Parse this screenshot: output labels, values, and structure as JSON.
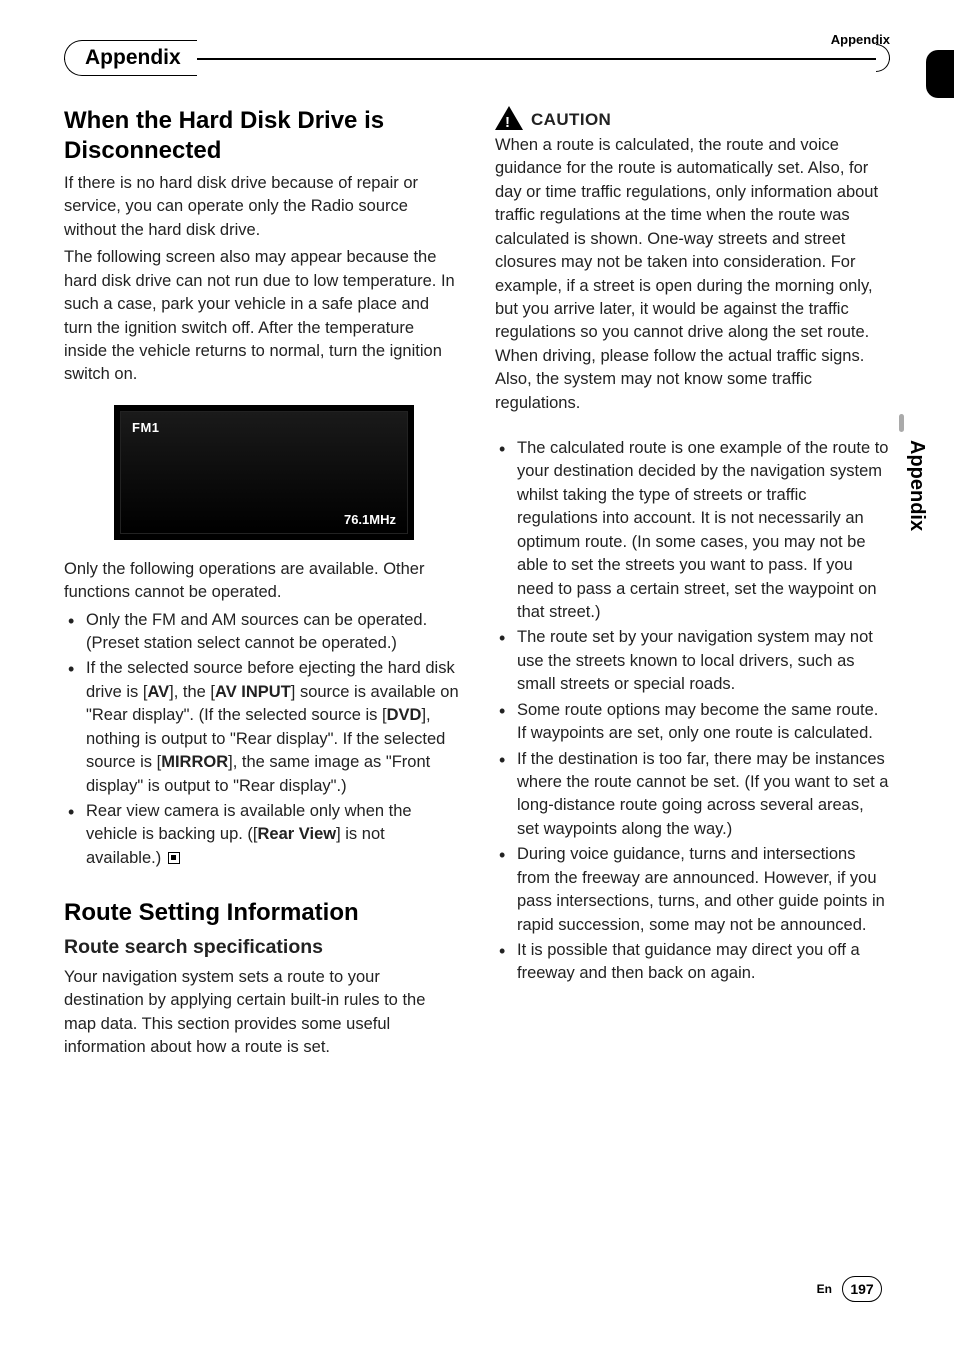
{
  "header": {
    "rightLabel": "Appendix",
    "tabTitle": "Appendix"
  },
  "left": {
    "h1": "When the Hard Disk Drive is Disconnected",
    "p1": "If there is no hard disk drive because of repair or service, you can operate only the Radio source without the hard disk drive.",
    "p2": "The following screen also may appear because the hard disk drive can not run due to low temperature. In such a case, park your vehicle in a safe place and turn the ignition switch off. After the temperature inside the vehicle returns to normal, turn the ignition switch on.",
    "screen": {
      "band": "FM1",
      "freq": "76.1MHz"
    },
    "p3": "Only the following operations are available. Other functions cannot be operated.",
    "bullets": {
      "b1": "Only the FM and AM sources can be operated. (Preset station select cannot be operated.)",
      "b2a": "If the selected source before ejecting the hard disk drive is [",
      "b2av": "AV",
      "b2b": "], the [",
      "b2bv": "AV INPUT",
      "b2c": "] source is available on \"Rear display\". (If the selected source is [",
      "b2cv": "DVD",
      "b2d": "], nothing is output to \"Rear display\". If the selected source is [",
      "b2dv": "MIRROR",
      "b2e": "], the same image as \"Front display\" is output to \"Rear display\".)",
      "b3a": "Rear view camera is available only when the vehicle is backing up. ([",
      "b3v": "Rear View",
      "b3b": "] is not available.)"
    },
    "h1b": "Route Setting Information",
    "h2": "Route search specifications",
    "p4": "Your navigation system sets a route to your destination by applying certain built-in rules to the map data. This section provides some useful information about how a route is set."
  },
  "right": {
    "caution": "CAUTION",
    "cautionText": "When a route is calculated, the route and voice guidance for the route is automatically set. Also, for day or time traffic regulations, only information about traffic regulations at the time when the route was calculated is shown. One-way streets and street closures may not be taken into consideration. For example, if a street is open during the morning only, but you arrive later, it would be against the traffic regulations so you cannot drive along the set route. When driving, please follow the actual traffic signs. Also, the system may not know some traffic regulations.",
    "bullets": {
      "r1": "The calculated route is one example of the route to your destination decided by the navigation system whilst taking the type of streets or traffic regulations into account. It is not necessarily an optimum route. (In some cases, you may not be able to set the streets you want to pass. If you need to pass a certain street, set the waypoint on that street.)",
      "r2": "The route set by your navigation system may not use the streets known to local drivers, such as small streets or special roads.",
      "r3": "Some route options may become the same route. If waypoints are set, only one route is calculated.",
      "r4": "If the destination is too far, there may be instances where the route cannot be set. (If you want to set a long-distance route going across several areas, set waypoints along the way.)",
      "r5": "During voice guidance, turns and intersections from the freeway are announced. However, if you pass intersections, turns, and other guide points in rapid succession, some may not be announced.",
      "r6": "It is possible that guidance may direct you off a freeway and then back on again."
    }
  },
  "side": {
    "label": "Appendix"
  },
  "footer": {
    "lang": "En",
    "page": "197"
  }
}
